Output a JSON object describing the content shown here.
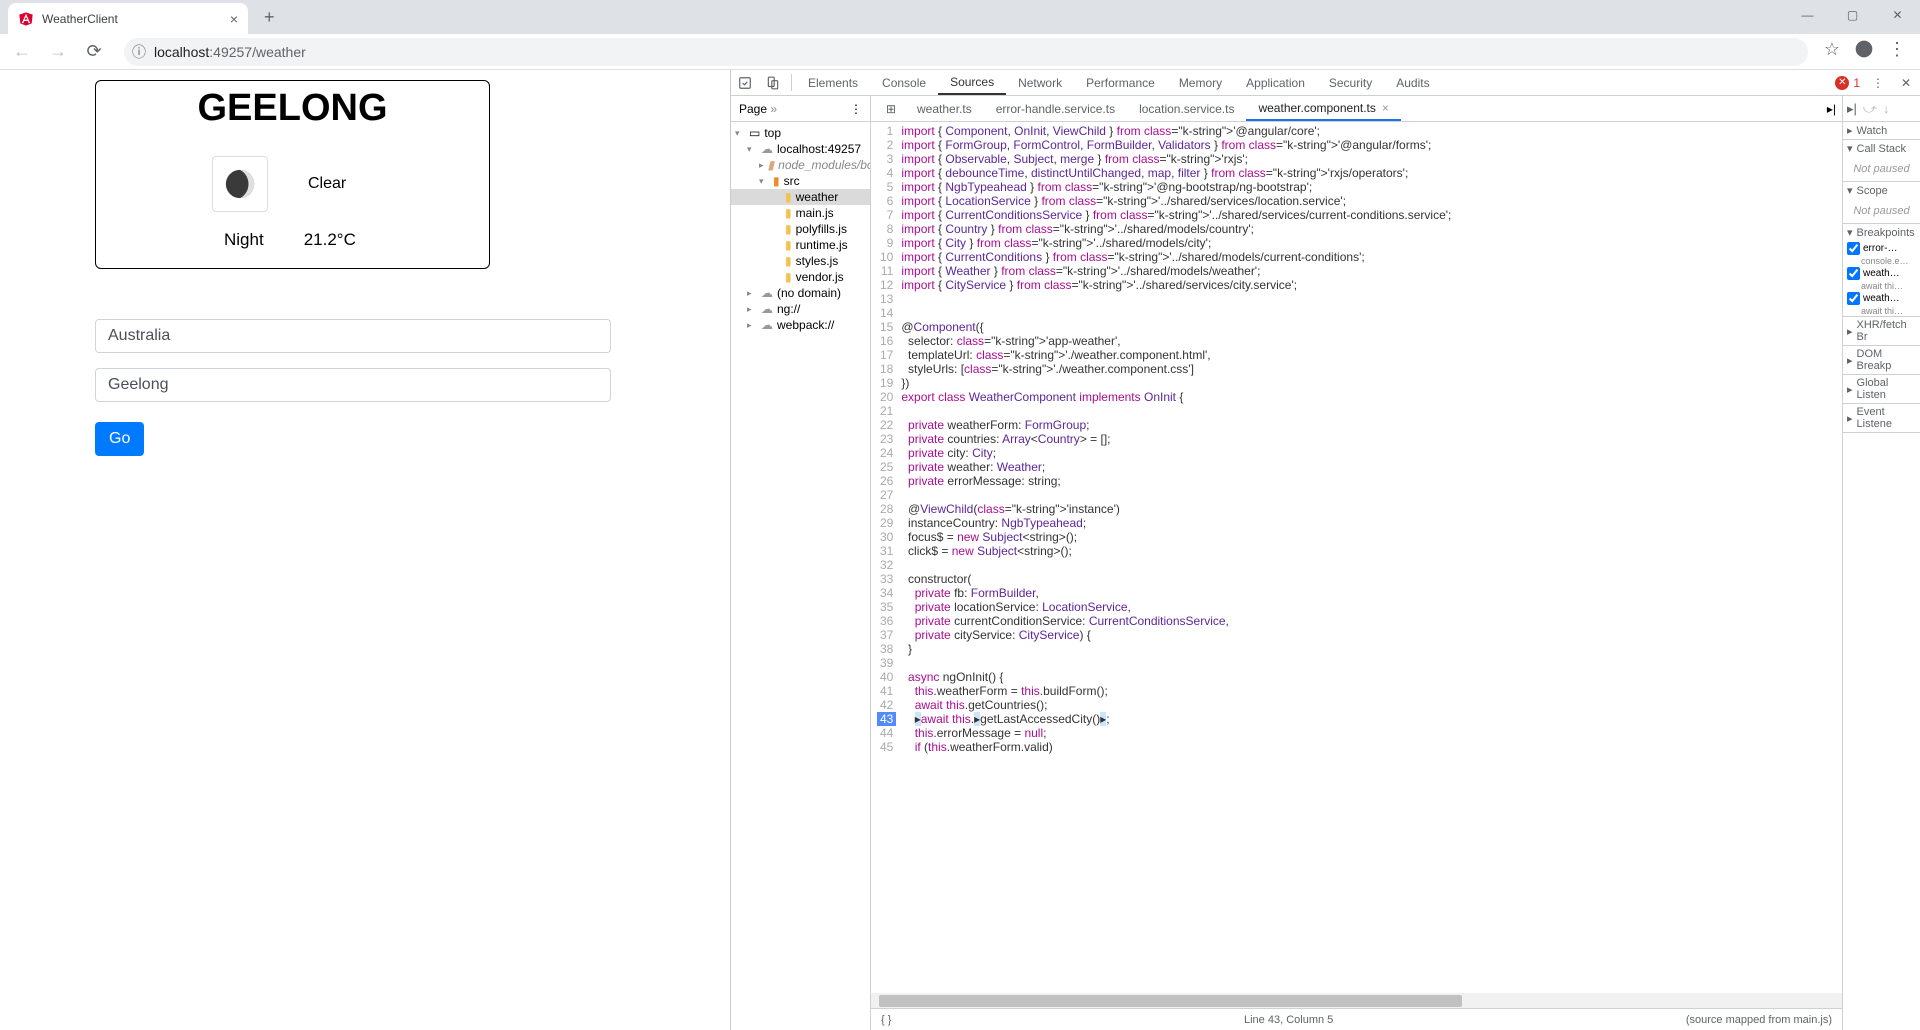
{
  "browser": {
    "tab_title": "WeatherClient",
    "url_display": "localhost:49257/weather",
    "url_host": "localhost",
    "url_port": ":49257",
    "url_path": "/weather"
  },
  "weather": {
    "city_heading": "GEELONG",
    "condition": "Clear",
    "daypart": "Night",
    "temperature": "21.2°C"
  },
  "form": {
    "country_value": "Australia",
    "city_value": "Geelong",
    "go_label": "Go"
  },
  "devtools": {
    "tabs": [
      "Elements",
      "Console",
      "Sources",
      "Network",
      "Performance",
      "Memory",
      "Application",
      "Security",
      "Audits"
    ],
    "active_tab": "Sources",
    "error_count": "1",
    "page_dropdown": "Page",
    "file_tree": {
      "top": "top",
      "host": "localhost:49257",
      "node_modules": "node_modules/bo",
      "src": "src",
      "files": [
        "weather",
        "main.js",
        "polyfills.js",
        "runtime.js",
        "styles.js",
        "vendor.js"
      ],
      "no_domain": "(no domain)",
      "ng": "ng://",
      "webpack": "webpack://"
    },
    "file_tabs": [
      "weather.ts",
      "error-handle.service.ts",
      "location.service.ts",
      "weather.component.ts"
    ],
    "active_file": "weather.component.ts",
    "breakpoint_line": 43,
    "code_lines": [
      {
        "n": 1,
        "t": "import { Component, OnInit, ViewChild } from '@angular/core';"
      },
      {
        "n": 2,
        "t": "import { FormGroup, FormControl, FormBuilder, Validators } from '@angular/forms';"
      },
      {
        "n": 3,
        "t": "import { Observable, Subject, merge } from 'rxjs';"
      },
      {
        "n": 4,
        "t": "import { debounceTime, distinctUntilChanged, map, filter } from 'rxjs/operators';"
      },
      {
        "n": 5,
        "t": "import { NgbTypeahead } from '@ng-bootstrap/ng-bootstrap';"
      },
      {
        "n": 6,
        "t": "import { LocationService } from '../shared/services/location.service';"
      },
      {
        "n": 7,
        "t": "import { CurrentConditionsService } from '../shared/services/current-conditions.service';"
      },
      {
        "n": 8,
        "t": "import { Country } from '../shared/models/country';"
      },
      {
        "n": 9,
        "t": "import { City } from '../shared/models/city';"
      },
      {
        "n": 10,
        "t": "import { CurrentConditions } from '../shared/models/current-conditions';"
      },
      {
        "n": 11,
        "t": "import { Weather } from '../shared/models/weather';"
      },
      {
        "n": 12,
        "t": "import { CityService } from '../shared/services/city.service';"
      },
      {
        "n": 13,
        "t": ""
      },
      {
        "n": 14,
        "t": ""
      },
      {
        "n": 15,
        "t": "@Component({"
      },
      {
        "n": 16,
        "t": "  selector: 'app-weather',"
      },
      {
        "n": 17,
        "t": "  templateUrl: './weather.component.html',"
      },
      {
        "n": 18,
        "t": "  styleUrls: ['./weather.component.css']"
      },
      {
        "n": 19,
        "t": "})"
      },
      {
        "n": 20,
        "t": "export class WeatherComponent implements OnInit {"
      },
      {
        "n": 21,
        "t": ""
      },
      {
        "n": 22,
        "t": "  private weatherForm: FormGroup;"
      },
      {
        "n": 23,
        "t": "  private countries: Array<Country> = [];"
      },
      {
        "n": 24,
        "t": "  private city: City;"
      },
      {
        "n": 25,
        "t": "  private weather: Weather;"
      },
      {
        "n": 26,
        "t": "  private errorMessage: string;"
      },
      {
        "n": 27,
        "t": ""
      },
      {
        "n": 28,
        "t": "  @ViewChild('instance')"
      },
      {
        "n": 29,
        "t": "  instanceCountry: NgbTypeahead;"
      },
      {
        "n": 30,
        "t": "  focus$ = new Subject<string>();"
      },
      {
        "n": 31,
        "t": "  click$ = new Subject<string>();"
      },
      {
        "n": 32,
        "t": ""
      },
      {
        "n": 33,
        "t": "  constructor("
      },
      {
        "n": 34,
        "t": "    private fb: FormBuilder,"
      },
      {
        "n": 35,
        "t": "    private locationService: LocationService,"
      },
      {
        "n": 36,
        "t": "    private currentConditionService: CurrentConditionsService,"
      },
      {
        "n": 37,
        "t": "    private cityService: CityService) {"
      },
      {
        "n": 38,
        "t": "  }"
      },
      {
        "n": 39,
        "t": ""
      },
      {
        "n": 40,
        "t": "  async ngOnInit() {"
      },
      {
        "n": 41,
        "t": "    this.weatherForm = this.buildForm();"
      },
      {
        "n": 42,
        "t": "    await this.getCountries();"
      },
      {
        "n": 43,
        "t": "    await this.getLastAccessedCity();"
      },
      {
        "n": 44,
        "t": "    this.errorMessage = null;"
      },
      {
        "n": 45,
        "t": "    if (this.weatherForm.valid)"
      }
    ],
    "status_cursor": "Line 43, Column 5",
    "status_map": "(source mapped from main.js)",
    "right_panes": {
      "watch": "Watch",
      "callstack": "Call Stack",
      "scope": "Scope",
      "breakpoints": "Breakpoints",
      "not_paused": "Not paused",
      "xhr": "XHR/fetch Br",
      "dom": "DOM Breakp",
      "global": "Global Listen",
      "event": "Event Listene",
      "bp_items": [
        {
          "label": "error-…",
          "code": "console.e…"
        },
        {
          "label": "weath…",
          "code": "await thi…"
        },
        {
          "label": "weath…",
          "code": "await thi…"
        }
      ]
    }
  }
}
